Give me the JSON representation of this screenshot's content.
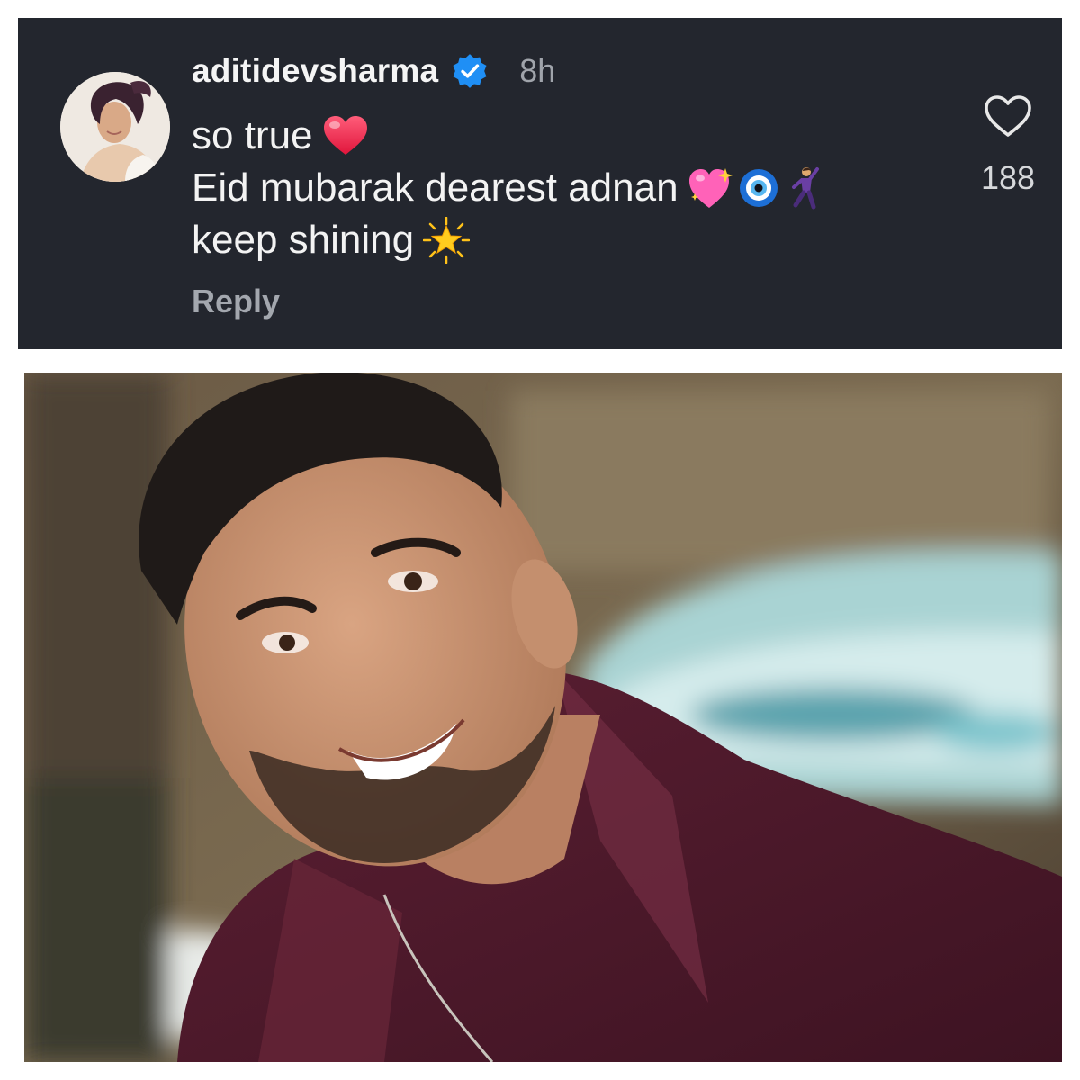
{
  "comment": {
    "username": "aditidevsharma",
    "verified": true,
    "time": "8h",
    "lines": [
      {
        "text": "so true",
        "emojis": [
          "red-heart"
        ]
      },
      {
        "text": "Eid mubarak dearest adnan",
        "emojis": [
          "sparkling-heart",
          "nazar-amulet",
          "dancing-man"
        ]
      },
      {
        "text": "keep shining",
        "emojis": [
          "glowing-star"
        ]
      }
    ],
    "reply_label": "Reply",
    "like_count": "188"
  },
  "colors": {
    "card_background": "#23262e",
    "verified_badge": "#1f8ff5",
    "muted_text": "#a0a4ab"
  },
  "photo": {
    "subject": "smiling man in maroon shirt",
    "background": "blurred outdoor scene with white car"
  }
}
